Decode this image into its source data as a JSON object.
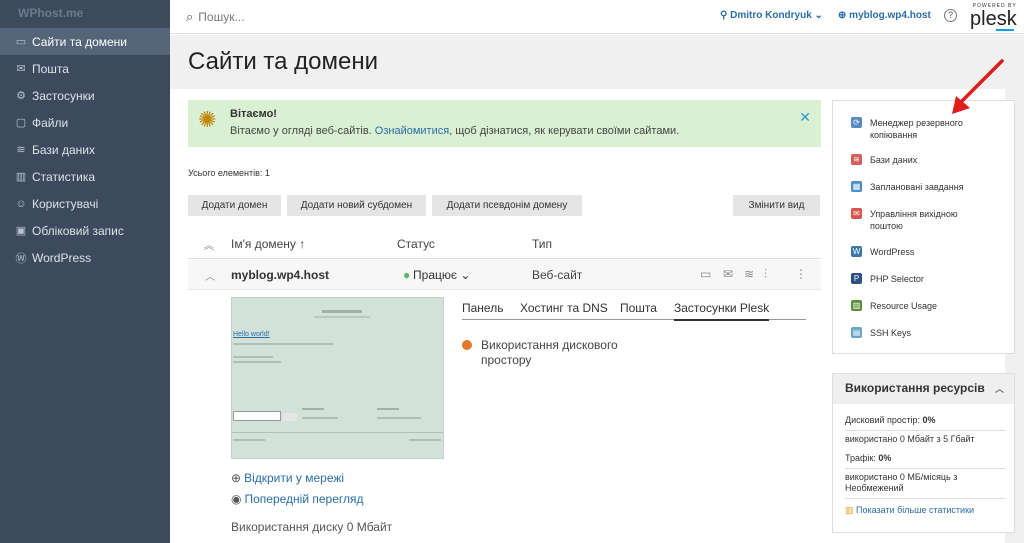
{
  "sidebar": {
    "logo": "WPhost.me",
    "items": [
      {
        "label": "Сайти та домени",
        "icon": "monitor-icon",
        "glyph": "▭"
      },
      {
        "label": "Пошта",
        "icon": "mail-icon",
        "glyph": "✉"
      },
      {
        "label": "Застосунки",
        "icon": "gear-icon",
        "glyph": "⚙"
      },
      {
        "label": "Файли",
        "icon": "folder-icon",
        "glyph": "▢"
      },
      {
        "label": "Бази даних",
        "icon": "database-icon",
        "glyph": "≋"
      },
      {
        "label": "Статистика",
        "icon": "chart-icon",
        "glyph": "▥"
      },
      {
        "label": "Користувачі",
        "icon": "user-icon",
        "glyph": "☺"
      },
      {
        "label": "Обліковий запис",
        "icon": "account-icon",
        "glyph": "▣"
      },
      {
        "label": "WordPress",
        "icon": "wordpress-icon",
        "glyph": "Ⓦ"
      }
    ]
  },
  "topbar": {
    "search_placeholder": "Пошук...",
    "user": "Dmitro Kondryuk ⌄",
    "domain": "myblog.wp4.host",
    "help": "?",
    "powered_by": "POWERED BY",
    "brand": "plesk"
  },
  "page": {
    "title": "Сайти та домени"
  },
  "welcome": {
    "title": "Вітаємо!",
    "text_before": "Вітаємо у огляді веб-сайтів. ",
    "link": "Ознайомитися",
    "text_after": ", щоб дізнатися, як керувати своїми сайтами.",
    "close": "✕"
  },
  "total": "Усього елементів: 1",
  "buttons": {
    "add_domain": "Додати домен",
    "add_subdomain": "Додати новий субдомен",
    "add_alias": "Додати псевдонім домену",
    "change_view": "Змінити вид"
  },
  "table": {
    "col_name": "Ім'я домену ↑",
    "col_status": "Статус",
    "col_type": "Тип",
    "row": {
      "name": "myblog.wp4.host",
      "status": "Працює ⌄",
      "type": "Веб-сайт"
    }
  },
  "tabs": {
    "panel": "Панель",
    "hosting": "Хостинг та DNS",
    "mail": "Пошта",
    "apps": "Застосунки Plesk"
  },
  "app_item": {
    "line1": "Використання дискового",
    "line2": "простору"
  },
  "links": {
    "open_web": "Відкрити у мережі",
    "preview": "Попередній перегляд"
  },
  "disk_usage": "Використання диску 0 Мбайт",
  "right_panel": {
    "items": [
      {
        "label": "Менеджер резервного копіювання",
        "icon": "backup-icon",
        "color": "#5a8ac4",
        "glyph": "⟳"
      },
      {
        "label": "Бази даних",
        "icon": "database-icon",
        "color": "#d65d5d",
        "glyph": "≋"
      },
      {
        "label": "Заплановані завдання",
        "icon": "calendar-icon",
        "color": "#4e8fc9",
        "glyph": "▦"
      },
      {
        "label": "Управління вихідною поштою",
        "icon": "mail-icon",
        "color": "#d9534f",
        "glyph": "✉"
      },
      {
        "label": "WordPress",
        "icon": "wordpress-icon",
        "color": "#3a78a8",
        "glyph": "W"
      },
      {
        "label": "PHP Selector",
        "icon": "php-icon",
        "color": "#2d4f8a",
        "glyph": "P"
      },
      {
        "label": "Resource Usage",
        "icon": "resource-icon",
        "color": "#5c8f3a",
        "glyph": "▥"
      },
      {
        "label": "SSH Keys",
        "icon": "ssh-key-icon",
        "color": "#6aa3c9",
        "glyph": "▤"
      }
    ]
  },
  "resources": {
    "title": "Використання ресурсів",
    "chevron": "︿",
    "disk_label": "Дисковий простір: ",
    "disk_value": "0%",
    "disk_detail": "використано 0 Мбайт з 5 Гбайт",
    "traffic_label": "Трафік: ",
    "traffic_value": "0%",
    "traffic_detail1": "використано 0 МБ/місяць з",
    "traffic_detail2": "Необмежений",
    "more": "Показати більше статистики"
  },
  "thumbnail": {
    "hello": "Hello world!"
  }
}
